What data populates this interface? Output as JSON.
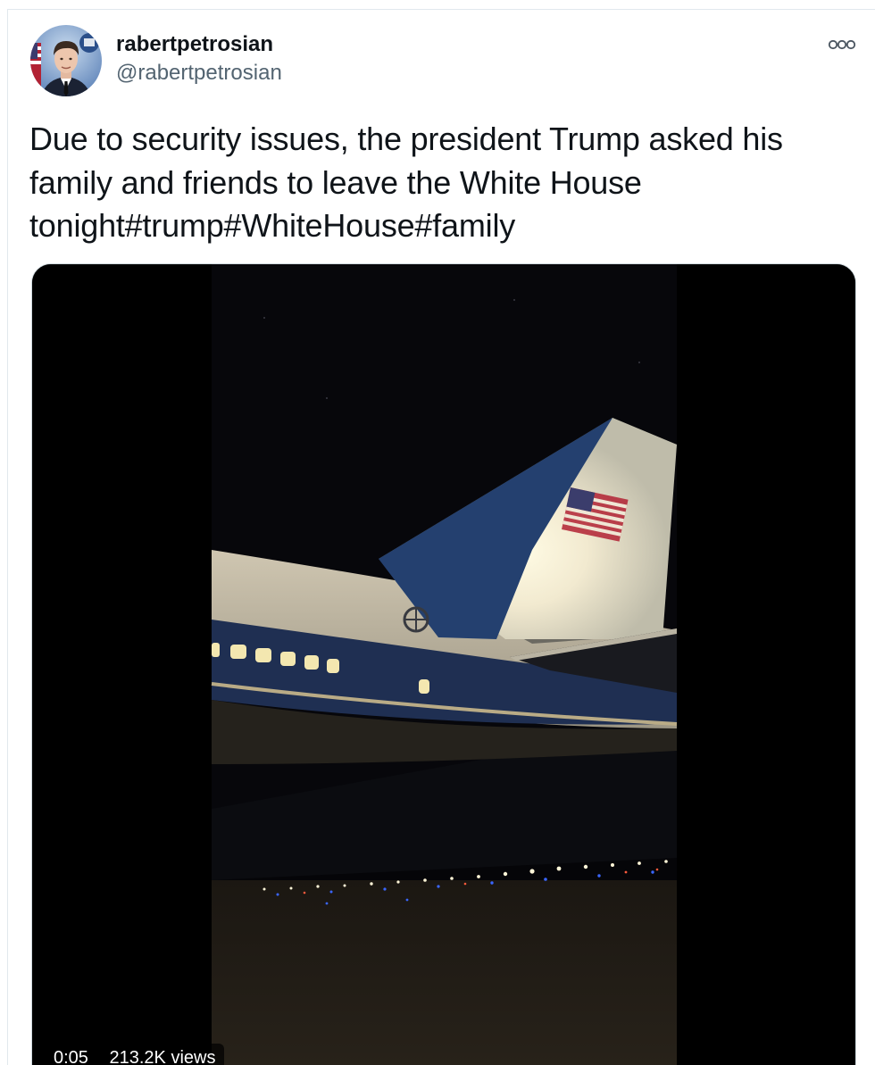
{
  "tweet": {
    "author": {
      "name": "rabertpetrosian",
      "handle": "@rabertpetrosian",
      "avatar_icon": "avatar-photo"
    },
    "more_icon": "more-horizontal-icon",
    "text": "Due to security issues, the president Trump asked his family and friends to leave the White House tonight#trump#WhiteHouse#family",
    "media": {
      "type": "video",
      "time": "0:05",
      "views": "213.2K views"
    }
  },
  "colors": {
    "text_primary": "#0f1419",
    "text_secondary": "#536471",
    "border": "#e1e8ed"
  }
}
